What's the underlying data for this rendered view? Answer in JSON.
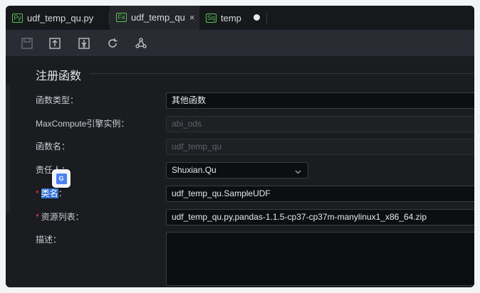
{
  "tabs": [
    {
      "badge": "Py",
      "label": "udf_temp_qu.py",
      "active": false
    },
    {
      "badge": "Fx",
      "label": "udf_temp_qu",
      "active": true,
      "close": "×"
    },
    {
      "badge": "Sq",
      "label": "temp",
      "active": false
    }
  ],
  "toolbar": {
    "icons": [
      "save-icon",
      "submit-icon",
      "publish-icon",
      "refresh-icon",
      "lineage-icon"
    ]
  },
  "form": {
    "section_title": "注册函数",
    "function_type": {
      "label": "函数类型：",
      "value": "其他函数"
    },
    "instance": {
      "label": "MaxCompute引擎实例：",
      "placeholder": "abi_ods"
    },
    "function_name": {
      "label": "函数名：",
      "placeholder": "udf_temp_qu"
    },
    "owner": {
      "label_part": "责任",
      "label_end": "人：",
      "value": "Shuxian.Qu"
    },
    "class_name": {
      "required": "*",
      "label_hl": "类名",
      "label_end": "：",
      "value": "udf_temp_qu.SampleUDF"
    },
    "resources": {
      "required": "*",
      "label": "资源列表：",
      "value": "udf_temp_qu.py,pandas-1.1.5-cp37-cp37m-manylinux1_x86_64.zip"
    },
    "description": {
      "label": "描述："
    }
  },
  "translate_popup": {
    "glyph": "G"
  },
  "colors": {
    "accent_green": "#58c257",
    "required_red": "#e0463c",
    "highlight_blue": "#2f6fd8"
  }
}
